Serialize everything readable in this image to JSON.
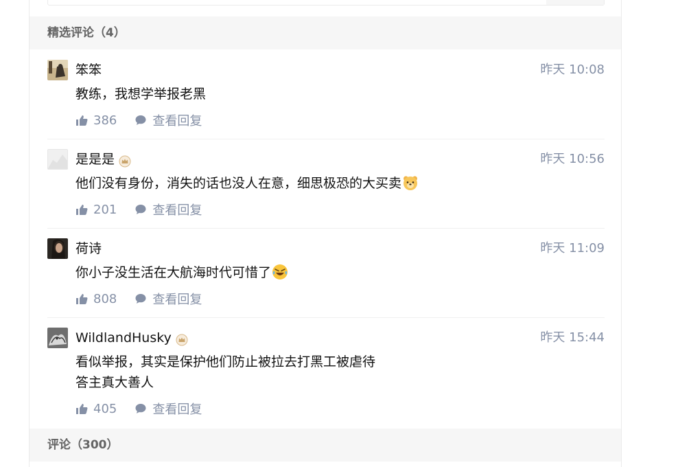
{
  "featured_header": "精选评论（4）",
  "comments_header": "评论（300）",
  "colors": {
    "accent_gray": "#8590a6",
    "badge": "#c9a46b"
  },
  "comments": [
    {
      "author": "笨笨",
      "badge": false,
      "time": "昨天 10:08",
      "lines": [
        "教练，我想学举报老黑"
      ],
      "emoji": null,
      "likes": "386",
      "reply_label": "查看回复"
    },
    {
      "author": "是是是",
      "badge": true,
      "time": "昨天 10:56",
      "lines": [
        "他们没有身份，消失的话也没人在意，细思极恐的大买卖"
      ],
      "emoji": "bear-face-icon",
      "likes": "201",
      "reply_label": "查看回复"
    },
    {
      "author": "荷诗",
      "badge": false,
      "time": "昨天 11:09",
      "lines": [
        "你小子没生活在大航海时代可惜了"
      ],
      "emoji": "rolling-laugh-icon",
      "likes": "808",
      "reply_label": "查看回复"
    },
    {
      "author": "WildlandHusky",
      "badge": true,
      "time": "昨天 15:44",
      "lines": [
        "看似举报，其实是保护他们防止被拉去打黑工被虐待",
        "答主真大善人"
      ],
      "emoji": null,
      "likes": "405",
      "reply_label": "查看回复"
    }
  ]
}
